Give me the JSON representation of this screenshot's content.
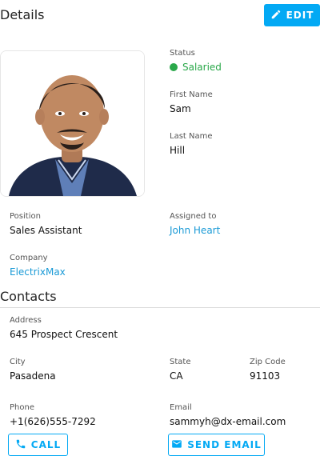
{
  "header": {
    "title": "Details",
    "edit_label": "EDIT"
  },
  "profile": {
    "status_label": "Status",
    "status_value": "Salaried",
    "first_name_label": "First Name",
    "first_name": "Sam",
    "last_name_label": "Last Name",
    "last_name": "Hill",
    "position_label": "Position",
    "position": "Sales Assistant",
    "assigned_label": "Assigned to",
    "assigned_to": "John Heart",
    "company_label": "Company",
    "company": "ElectrixMax"
  },
  "contacts": {
    "title": "Contacts",
    "address_label": "Address",
    "address": "645 Prospect Crescent",
    "city_label": "City",
    "city": "Pasadena",
    "state_label": "State",
    "state": "CA",
    "zip_label": "Zip Code",
    "zip": "91103",
    "phone_label": "Phone",
    "phone": "+1(626)555-7292",
    "email_label": "Email",
    "email": "sammyh@dx-email.com",
    "call_label": "CALL",
    "send_email_label": "SEND EMAIL"
  },
  "colors": {
    "accent": "#03a9f4",
    "link": "#1a9ad6",
    "status": "#2aa84a"
  },
  "icons": {
    "edit": "pencil-icon",
    "call": "phone-icon",
    "email": "envelope-icon"
  }
}
